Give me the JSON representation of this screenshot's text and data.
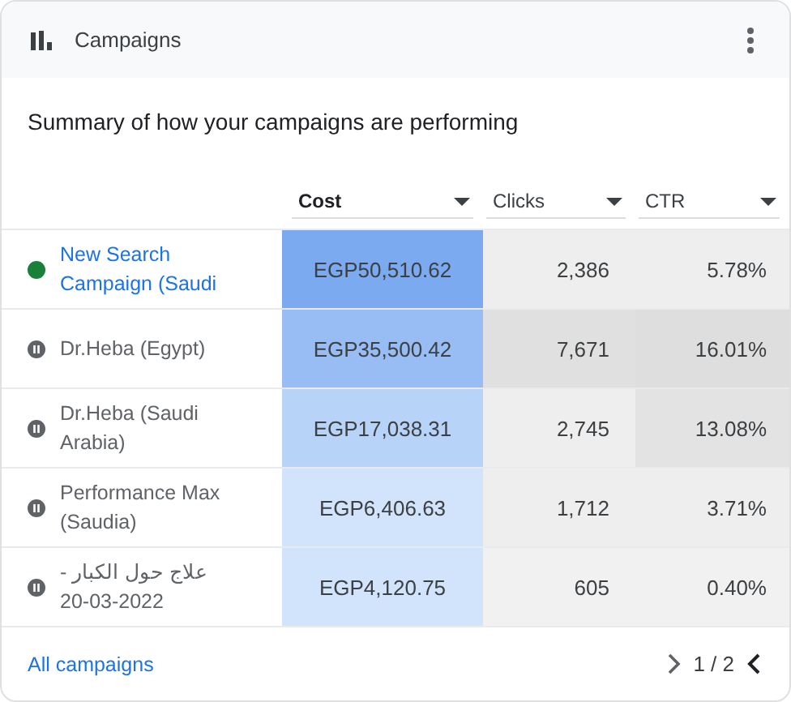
{
  "card": {
    "title": "Campaigns",
    "subtitle": "Summary of how your campaigns are performing"
  },
  "table": {
    "columns": [
      {
        "label": "Cost",
        "selected": true
      },
      {
        "label": "Clicks",
        "selected": false
      },
      {
        "label": "CTR",
        "selected": false
      }
    ],
    "rows": [
      {
        "name": "New Search Campaign (Saudi",
        "kind": "enabled",
        "cells": [
          {
            "text": "EGP50,510.62",
            "color": "#7baaf0"
          },
          {
            "text": "2,386",
            "color": "#eeeeee"
          },
          {
            "text": "5.78%",
            "color": "#eeeeee"
          }
        ]
      },
      {
        "name": "Dr.Heba (Egypt)",
        "kind": "paused",
        "cells": [
          {
            "text": "EGP35,500.42",
            "color": "#98bdf4"
          },
          {
            "text": "7,671",
            "color": "#e0e0e0"
          },
          {
            "text": "16.01%",
            "color": "#dedede"
          }
        ]
      },
      {
        "name": "Dr.Heba (Saudi Arabia)",
        "kind": "paused",
        "cells": [
          {
            "text": "EGP17,038.31",
            "color": "#b8d3f8"
          },
          {
            "text": "2,745",
            "color": "#eeeeee"
          },
          {
            "text": "13.08%",
            "color": "#e3e3e3"
          }
        ]
      },
      {
        "name": "Performance Max (Saudia)",
        "kind": "paused",
        "cells": [
          {
            "text": "EGP6,406.63",
            "color": "#d2e3fc"
          },
          {
            "text": "1,712",
            "color": "#eeeeee"
          },
          {
            "text": "3.71%",
            "color": "#eeeeee"
          }
        ]
      },
      {
        "name": "علاج حول الكبار - 2022-03-20",
        "kind": "paused",
        "cells": [
          {
            "text": "EGP4,120.75",
            "color": "#d2e3fc"
          },
          {
            "text": "605",
            "color": "#f1f1f1"
          },
          {
            "text": "0.40%",
            "color": "#f1f1f1"
          }
        ]
      }
    ]
  },
  "footer": {
    "link": "All campaigns",
    "page": "1 / 2"
  }
}
